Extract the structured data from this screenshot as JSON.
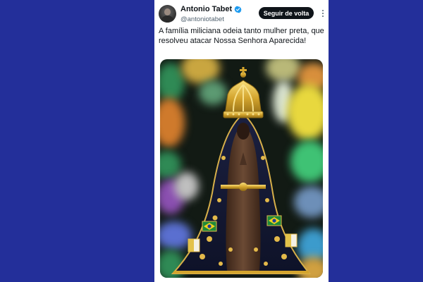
{
  "tweet": {
    "author": {
      "name": "Antonio Tabet",
      "handle": "@antoniotabet",
      "verified": true
    },
    "follow_label": "Seguir de volta",
    "text": "A família miliciana odeia tanto mulher preta, que resolveu atacar Nossa Senhora Aparecida!",
    "media": {
      "icon": "statue-image"
    }
  },
  "colors": {
    "page_background": "#232f9a",
    "card_background": "#ffffff",
    "button_background": "#0f1419",
    "verified_badge": "#1d9bf0",
    "handle_text": "#536471"
  },
  "icons": {
    "verified": "verified-badge-icon",
    "more": "more-options-icon"
  }
}
